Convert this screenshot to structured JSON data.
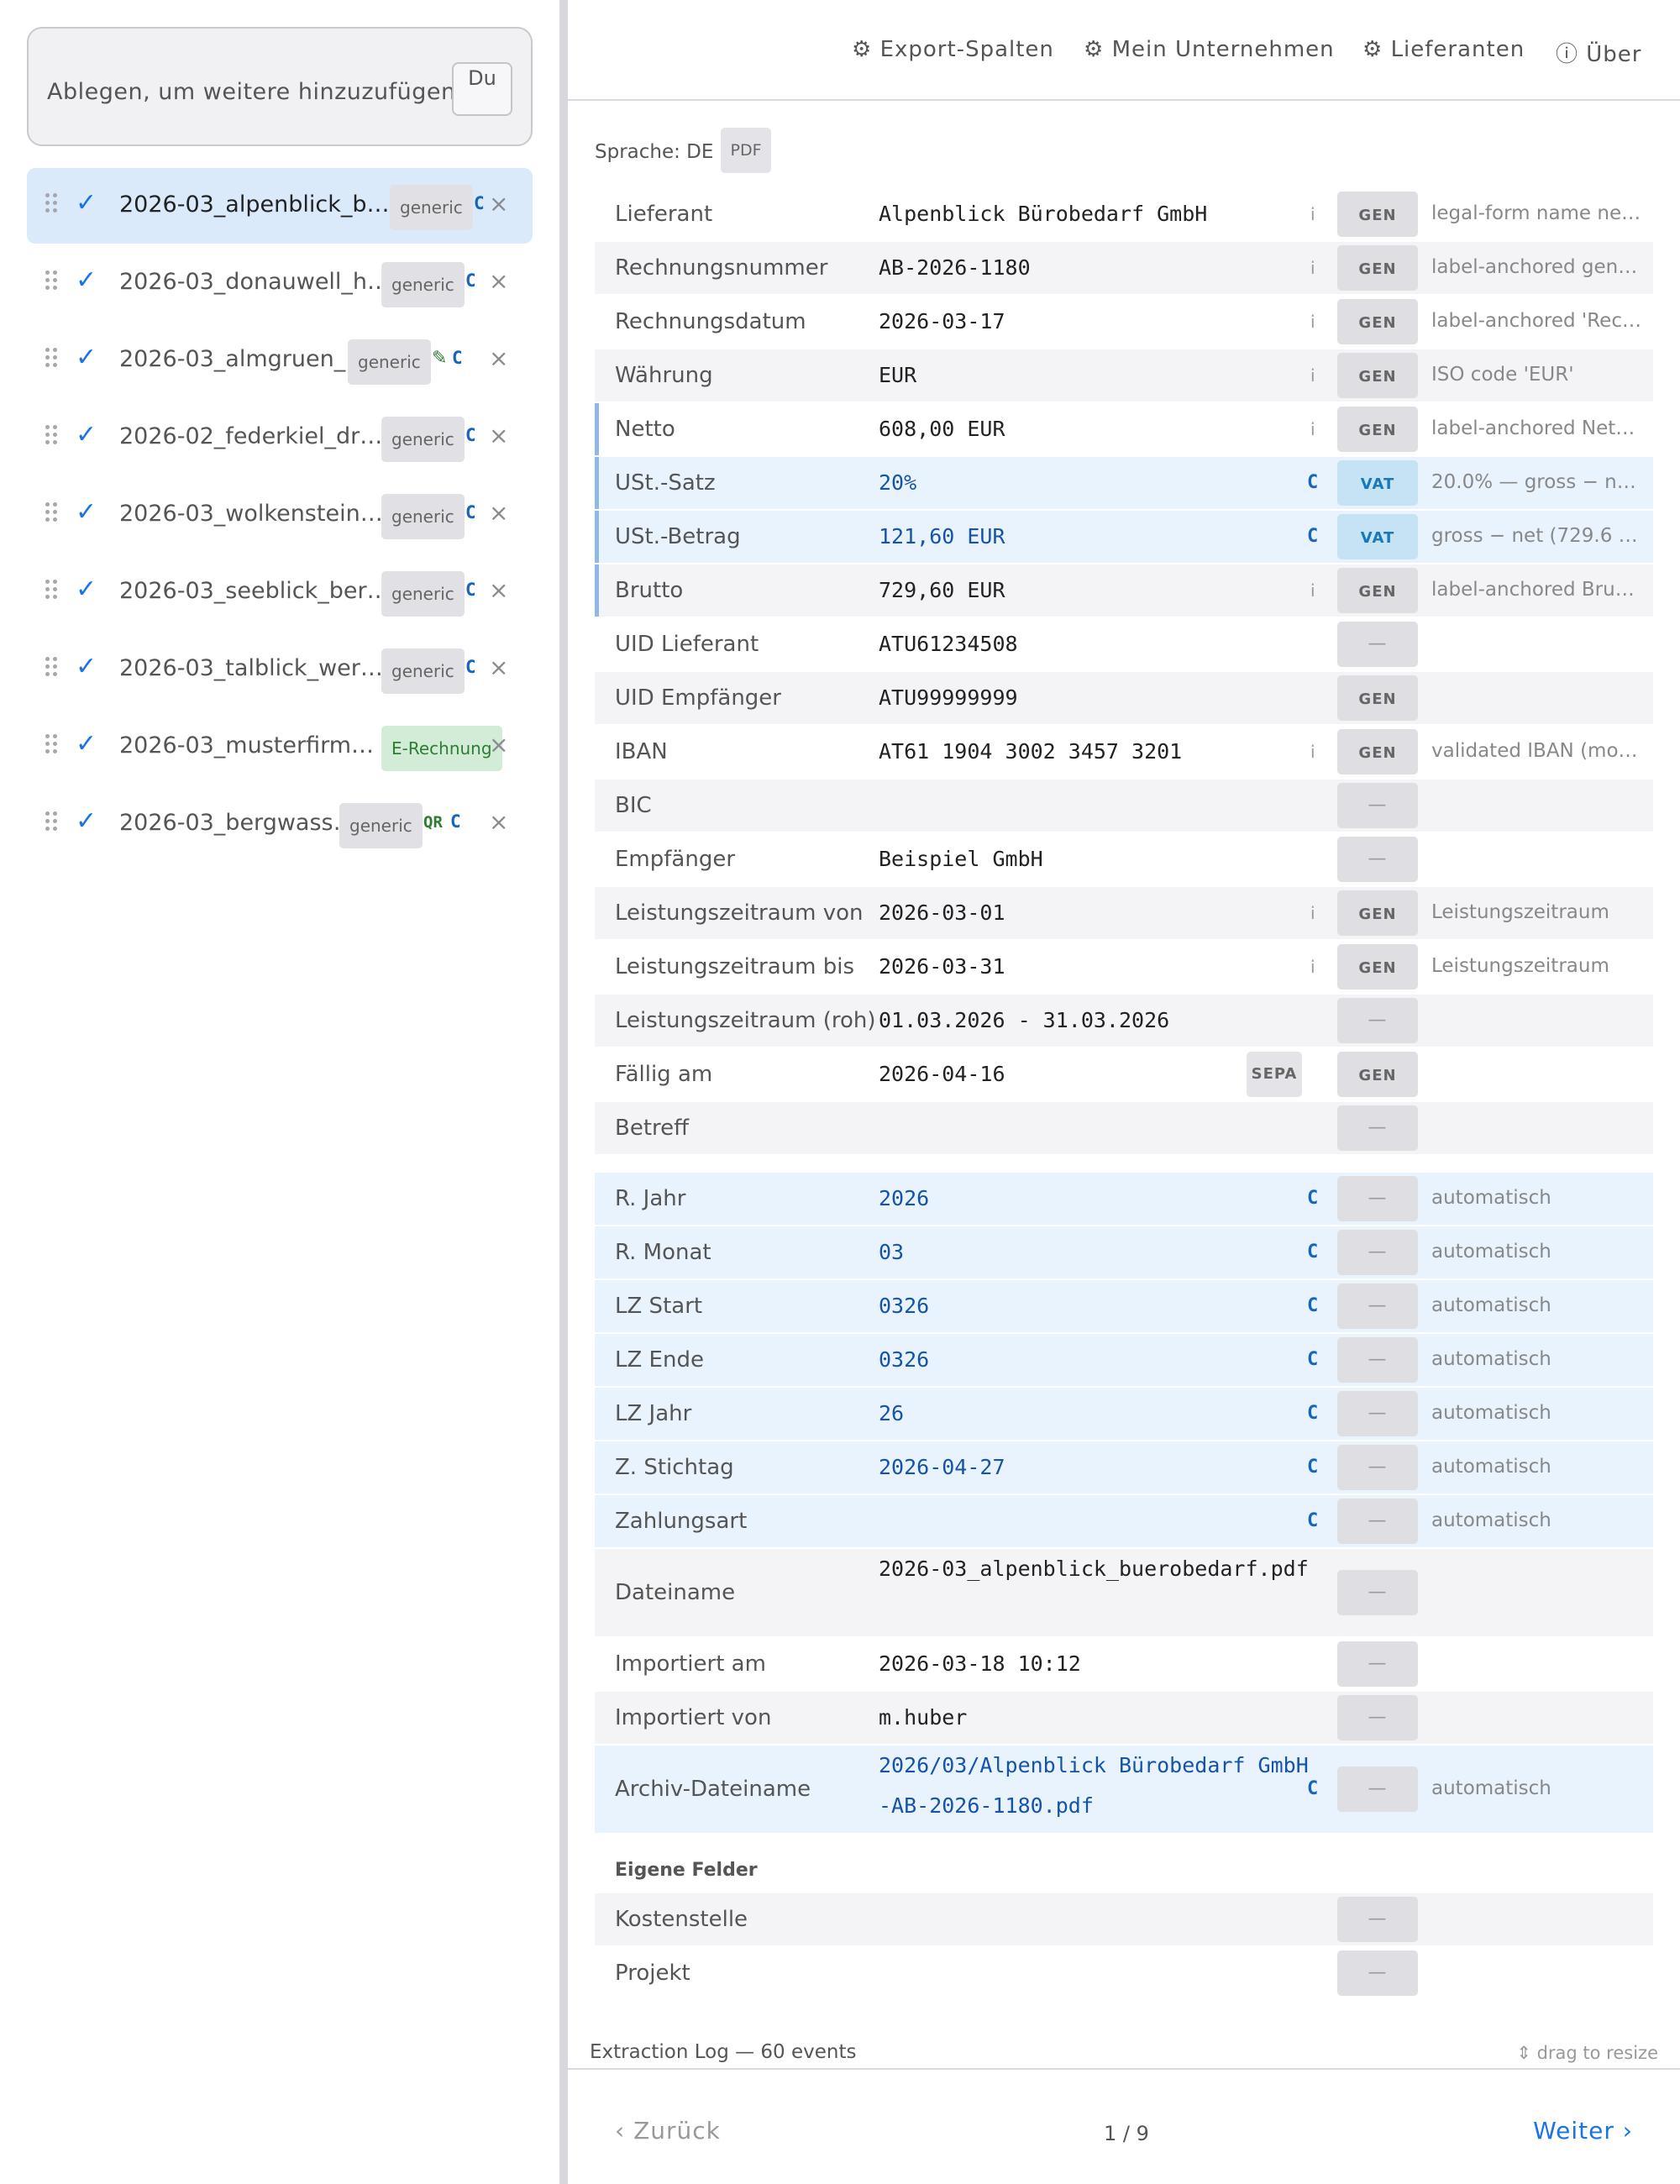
{
  "sidebar": {
    "dropzone_text": "Ablegen, um weitere hinzuzufügen",
    "dropzone_button": "Du",
    "files": [
      {
        "name": "2026-03_alpenblick_b…",
        "tag": "generic",
        "flags": [
          "C"
        ],
        "active": true
      },
      {
        "name": "2026-03_donauwell_h…",
        "tag": "generic",
        "flags": [
          "C"
        ],
        "active": false
      },
      {
        "name": "2026-03_almgruen_…",
        "tag": "generic",
        "flags": [
          "✎",
          "C"
        ],
        "active": false
      },
      {
        "name": "2026-02_federkiel_dr…",
        "tag": "generic",
        "flags": [
          "C"
        ],
        "active": false
      },
      {
        "name": "2026-03_wolkenstein…",
        "tag": "generic",
        "flags": [
          "C"
        ],
        "active": false
      },
      {
        "name": "2026-03_seeblick_ber…",
        "tag": "generic",
        "flags": [
          "C"
        ],
        "active": false
      },
      {
        "name": "2026-03_talblick_wer…",
        "tag": "generic",
        "flags": [
          "C"
        ],
        "active": false
      },
      {
        "name": "2026-03_musterfirm…",
        "tag": "E-Rechnung",
        "flags": [],
        "active": false
      },
      {
        "name": "2026-03_bergwass…",
        "tag": "generic",
        "flags": [
          "QR",
          "C"
        ],
        "active": false
      }
    ],
    "check_glyph": "✓",
    "remove_glyph": "×"
  },
  "nav": {
    "export_columns": "⚙ Export-Spalten",
    "my_company": "⚙ Mein Unternehmen",
    "suppliers": "⚙ Lieferanten",
    "about": "ⓘ Über"
  },
  "doc": {
    "language_label": "Sprache: DE",
    "pdf_badge": "PDF"
  },
  "fields": [
    {
      "label": "Lieferant",
      "value": "Alpenblick Bürobedarf GmbH",
      "ind": "i",
      "badge": "GEN",
      "note": "legal-form name ne…"
    },
    {
      "label": "Rechnungsnummer",
      "value": "AB-2026-1180",
      "ind": "i",
      "badge": "GEN",
      "note": "label-anchored gene…"
    },
    {
      "label": "Rechnungsdatum",
      "value": "2026-03-17",
      "ind": "i",
      "badge": "GEN",
      "note": "label-anchored 'Rec…"
    },
    {
      "label": "Währung",
      "value": "EUR",
      "ind": "i",
      "badge": "GEN",
      "note": "ISO code 'EUR'"
    },
    {
      "label": "Netto",
      "value": "608,00 EUR",
      "ind": "i",
      "badge": "GEN",
      "note": "label-anchored Nett…",
      "marked": true
    },
    {
      "label": "USt.-Satz",
      "value": "20%",
      "ind": "C",
      "badge": "VAT",
      "note": "20.0% — gross − ne…",
      "marked": true,
      "hl": true
    },
    {
      "label": "USt.-Betrag",
      "value": "121,60 EUR",
      "ind": "C",
      "badge": "VAT",
      "note": "gross − net (729.6 …",
      "marked": true,
      "hl": true
    },
    {
      "label": "Brutto",
      "value": "729,60 EUR",
      "ind": "i",
      "badge": "GEN",
      "note": "label-anchored Brut…",
      "marked": true
    },
    {
      "label": "UID Lieferant",
      "value": "ATU61234508",
      "ind": "",
      "badge": "—",
      "note": ""
    },
    {
      "label": "UID Empfänger",
      "value": "ATU99999999",
      "ind": "",
      "badge": "GEN",
      "note": ""
    },
    {
      "label": "IBAN",
      "value": "AT61 1904 3002 3457 3201",
      "ind": "i",
      "badge": "GEN",
      "note": "validated IBAN (mo…"
    },
    {
      "label": "BIC",
      "value": "",
      "ind": "",
      "badge": "—",
      "note": ""
    },
    {
      "label": "Empfänger",
      "value": "Beispiel GmbH",
      "ind": "",
      "badge": "—",
      "note": ""
    },
    {
      "label": "Leistungszeitraum von",
      "value": "2026-03-01",
      "ind": "i",
      "badge": "GEN",
      "note": "Leistungszeitraum"
    },
    {
      "label": "Leistungszeitraum bis",
      "value": "2026-03-31",
      "ind": "i",
      "badge": "GEN",
      "note": "Leistungszeitraum"
    },
    {
      "label": "Leistungszeitraum (roh)",
      "value": "01.03.2026 - 31.03.2026",
      "ind": "",
      "badge": "—",
      "note": ""
    },
    {
      "label": "Fällig am",
      "value": "2026-04-16",
      "ind": "",
      "sepa": "SEPA",
      "badge": "GEN",
      "note": ""
    },
    {
      "label": "Betreff",
      "value": "",
      "ind": "",
      "badge": "—",
      "note": ""
    }
  ],
  "computed_fields": [
    {
      "label": "R. Jahr",
      "value": "2026",
      "ind": "C",
      "badge": "—",
      "note": "automatisch"
    },
    {
      "label": "R. Monat",
      "value": "03",
      "ind": "C",
      "badge": "—",
      "note": "automatisch"
    },
    {
      "label": "LZ Start",
      "value": "0326",
      "ind": "C",
      "badge": "—",
      "note": "automatisch"
    },
    {
      "label": "LZ Ende",
      "value": "0326",
      "ind": "C",
      "badge": "—",
      "note": "automatisch"
    },
    {
      "label": "LZ Jahr",
      "value": "26",
      "ind": "C",
      "badge": "—",
      "note": "automatisch"
    },
    {
      "label": "Z. Stichtag",
      "value": "2026-04-27",
      "ind": "C",
      "badge": "—",
      "note": "automatisch"
    },
    {
      "label": "Zahlungsart",
      "value": "",
      "ind": "C",
      "badge": "—",
      "note": "automatisch"
    }
  ],
  "meta_fields": [
    {
      "label": "Dateiname",
      "value": "2026-03_alpenblick_buerobedarf.pdf",
      "ind": "",
      "badge": "—",
      "note": "",
      "tall": true
    },
    {
      "label": "Importiert am",
      "value": "2026-03-18 10:12",
      "ind": "",
      "badge": "—",
      "note": ""
    },
    {
      "label": "Importiert von",
      "value": "m.huber",
      "ind": "",
      "badge": "—",
      "note": ""
    },
    {
      "label": "Archiv-Dateiname",
      "value": "2026/03/Alpenblick Bürobedarf GmbH-AB-2026-1180.pdf",
      "ind": "C",
      "badge": "—",
      "note": "automatisch",
      "tall": true,
      "hl": true
    }
  ],
  "custom": {
    "heading": "Eigene Felder",
    "fields": [
      {
        "label": "Kostenstelle",
        "value": "",
        "ind": "",
        "badge": "—",
        "note": ""
      },
      {
        "label": "Projekt",
        "value": "",
        "ind": "",
        "badge": "—",
        "note": ""
      }
    ]
  },
  "log": {
    "title": "Extraction Log — 60 events",
    "hint": "⇕ drag to resize"
  },
  "footer": {
    "back": "‹ Zurück",
    "page": "1 / 9",
    "next": "Weiter ›"
  }
}
